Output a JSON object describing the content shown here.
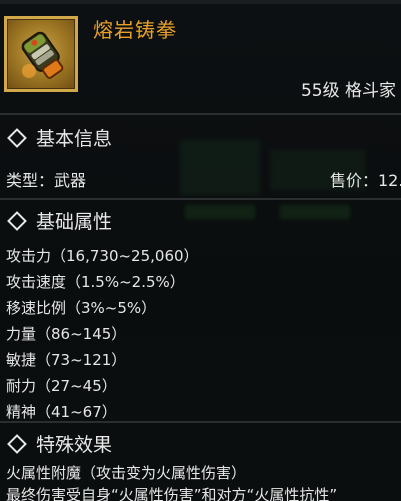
{
  "item": {
    "title": "熔岩铸拳",
    "level_class": "55级 格斗家",
    "icon": "lava-fist-gauntlet-icon"
  },
  "sections": {
    "basic_info": {
      "heading": "基本信息",
      "type_text": "类型：武器",
      "price_text": "售价：12."
    },
    "base_attributes": {
      "heading": "基础属性",
      "lines": [
        "攻击力（16,730~25,060）",
        "攻击速度（1.5%~2.5%）",
        "移速比例（3%~5%）",
        "力量（86~145）",
        "敏捷（73~121）",
        "耐力（27~45）",
        "精神（41~67）"
      ]
    },
    "special_effect": {
      "heading": "特殊效果",
      "line1": "火属性附魔（攻击变为火属性伤害）",
      "line2": "最终伤害受自身“火属性伤害”和对方“火属性抗性”"
    }
  },
  "colors": {
    "title": "#e7a02a",
    "text": "#e6e6e6",
    "frame": "#d2a94a",
    "background": "#0c0f10"
  }
}
